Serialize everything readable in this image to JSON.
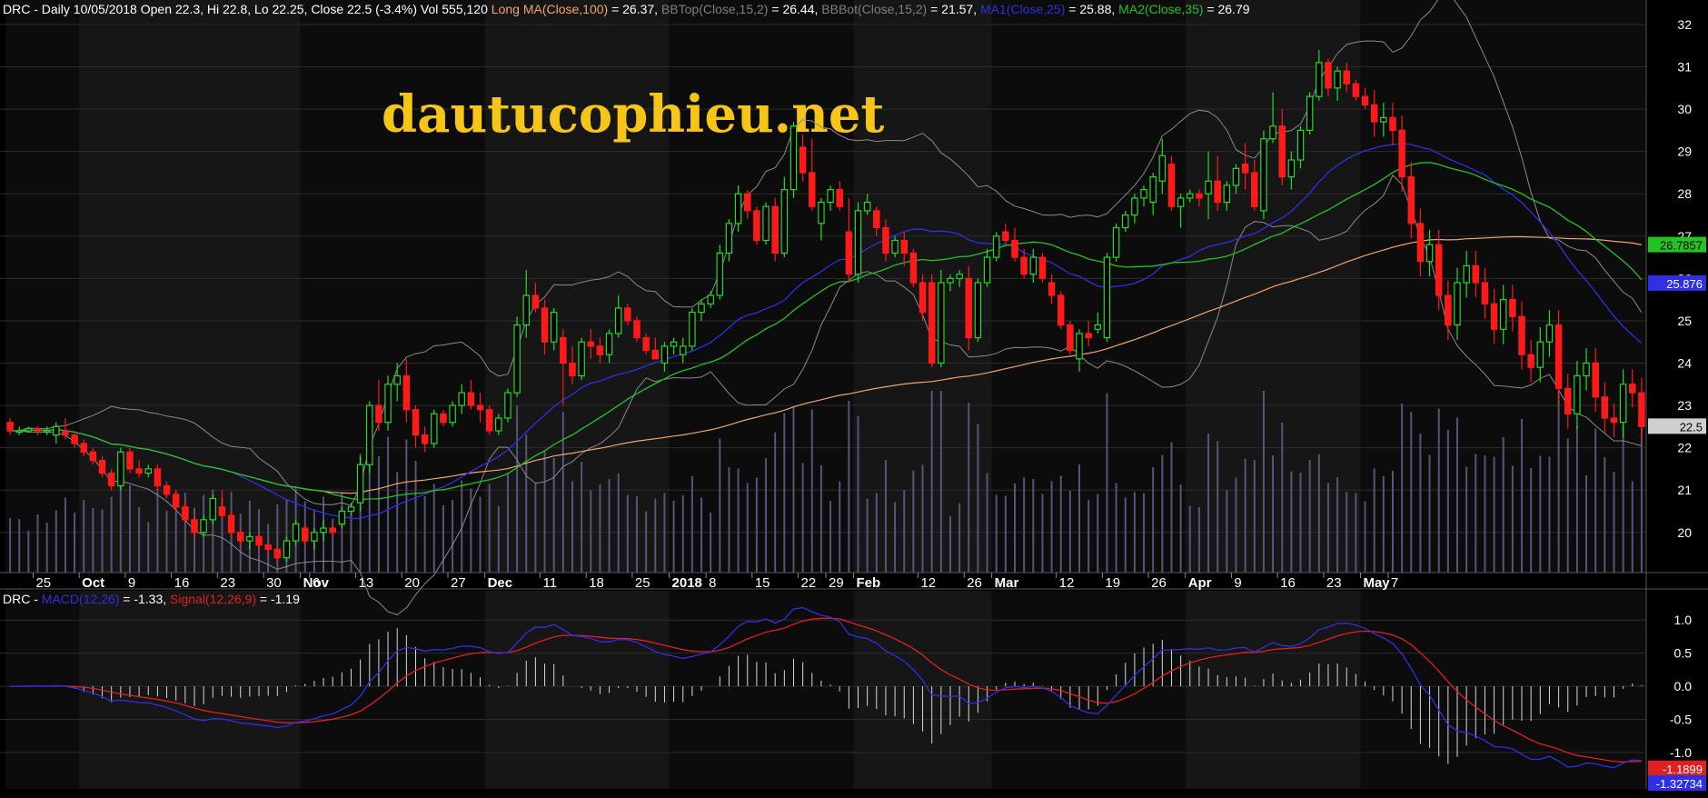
{
  "main_header": [
    {
      "text": "DRC - Daily 10/05/2018 Open 22.3, Hi 22.8, Lo 22.25, Close 22.5 (-3.4%) Vol 555,120 ",
      "color": "#ffffff"
    },
    {
      "text": "Long MA(Close,100)",
      "color": "#f3a46b"
    },
    {
      "text": " = 26.37, ",
      "color": "#ffffff"
    },
    {
      "text": "BBTop(Close,15,2)",
      "color": "#7f7f7f"
    },
    {
      "text": " = 26.44, ",
      "color": "#ffffff"
    },
    {
      "text": "BBBot(Close,15,2)",
      "color": "#7f7f7f"
    },
    {
      "text": " = 21.57, ",
      "color": "#ffffff"
    },
    {
      "text": "MA1(Close,25)",
      "color": "#2f2fe6"
    },
    {
      "text": " = 25.88, ",
      "color": "#ffffff"
    },
    {
      "text": "MA2(Close,35)",
      "color": "#22c322"
    },
    {
      "text": " = 26.79",
      "color": "#ffffff"
    }
  ],
  "macd_header": [
    {
      "text": "DRC - ",
      "color": "#ffffff"
    },
    {
      "text": "MACD(12,26)",
      "color": "#2f2fe6"
    },
    {
      "text": " = -1.33, ",
      "color": "#ffffff"
    },
    {
      "text": "Signal(12,26,9)",
      "color": "#e02020"
    },
    {
      "text": " = -1.19",
      "color": "#ffffff"
    }
  ],
  "watermark": "dautucophieu.net",
  "badges": {
    "ma2": "26.7857",
    "ma1": "25.876",
    "close": "22.5",
    "signal": "-1.1899",
    "macd": "-1.32734"
  },
  "chart_data": [
    {
      "type": "candlestick",
      "ticker": "DRC",
      "ylim": [
        19.05,
        32.15
      ],
      "y_ticks": [
        20,
        21,
        22,
        23,
        24,
        25,
        26,
        27,
        28,
        29,
        30,
        31,
        32
      ],
      "x_tick_labels": [
        {
          "label": "25",
          "bar": 3,
          "month": false
        },
        {
          "label": "Oct",
          "bar": 8,
          "month": true
        },
        {
          "label": "9",
          "bar": 13,
          "month": false
        },
        {
          "label": "16",
          "bar": 18,
          "month": false
        },
        {
          "label": "23",
          "bar": 23,
          "month": false
        },
        {
          "label": "30",
          "bar": 28,
          "month": false
        },
        {
          "label": "Nov",
          "bar": 32,
          "month": true
        },
        {
          "label": "6",
          "bar": 33,
          "month": false
        },
        {
          "label": "13",
          "bar": 38,
          "month": false
        },
        {
          "label": "20",
          "bar": 43,
          "month": false
        },
        {
          "label": "27",
          "bar": 48,
          "month": false
        },
        {
          "label": "Dec",
          "bar": 52,
          "month": true
        },
        {
          "label": "11",
          "bar": 58,
          "month": false
        },
        {
          "label": "18",
          "bar": 63,
          "month": false
        },
        {
          "label": "25",
          "bar": 68,
          "month": false
        },
        {
          "label": "2018",
          "bar": 72,
          "month": true
        },
        {
          "label": "8",
          "bar": 76,
          "month": false
        },
        {
          "label": "15",
          "bar": 81,
          "month": false
        },
        {
          "label": "22",
          "bar": 86,
          "month": false
        },
        {
          "label": "29",
          "bar": 89,
          "month": false
        },
        {
          "label": "Feb",
          "bar": 92,
          "month": true
        },
        {
          "label": "12",
          "bar": 99,
          "month": false
        },
        {
          "label": "26",
          "bar": 104,
          "month": false
        },
        {
          "label": "Mar",
          "bar": 107,
          "month": true
        },
        {
          "label": "12",
          "bar": 114,
          "month": false
        },
        {
          "label": "19",
          "bar": 119,
          "month": false
        },
        {
          "label": "26",
          "bar": 124,
          "month": false
        },
        {
          "label": "Apr",
          "bar": 128,
          "month": true
        },
        {
          "label": "9",
          "bar": 133,
          "month": false
        },
        {
          "label": "16",
          "bar": 138,
          "month": false
        },
        {
          "label": "23",
          "bar": 143,
          "month": false
        },
        {
          "label": "May",
          "bar": 147,
          "month": true
        },
        {
          "label": "7",
          "bar": 150,
          "month": false
        }
      ],
      "ohlc": [
        [
          22.6,
          22.7,
          22.3,
          22.4
        ],
        [
          22.4,
          22.5,
          22.3,
          22.4
        ],
        [
          22.4,
          22.5,
          22.35,
          22.45
        ],
        [
          22.45,
          22.5,
          22.3,
          22.4
        ],
        [
          22.4,
          22.5,
          22.3,
          22.4
        ],
        [
          22.3,
          22.6,
          22.1,
          22.5
        ],
        [
          22.4,
          22.7,
          22.2,
          22.3
        ],
        [
          22.3,
          22.4,
          22.0,
          22.1
        ],
        [
          22.1,
          22.2,
          21.8,
          21.9
        ],
        [
          21.9,
          22.0,
          21.6,
          21.7
        ],
        [
          21.7,
          21.8,
          21.3,
          21.4
        ],
        [
          21.4,
          21.5,
          21.0,
          21.1
        ],
        [
          21.1,
          22.0,
          21.0,
          21.9
        ],
        [
          21.9,
          22.0,
          21.4,
          21.5
        ],
        [
          21.5,
          21.7,
          21.3,
          21.4
        ],
        [
          21.4,
          21.6,
          21.3,
          21.5
        ],
        [
          21.5,
          21.6,
          21.0,
          21.1
        ],
        [
          21.1,
          21.2,
          20.8,
          20.9
        ],
        [
          20.9,
          21.0,
          20.5,
          20.6
        ],
        [
          20.6,
          20.8,
          20.2,
          20.3
        ],
        [
          20.3,
          20.4,
          19.9,
          20.0
        ],
        [
          20.0,
          20.4,
          19.9,
          20.3
        ],
        [
          20.3,
          20.9,
          20.2,
          20.8
        ],
        [
          20.6,
          21.0,
          20.3,
          20.4
        ],
        [
          20.4,
          20.5,
          19.9,
          20.0
        ],
        [
          20.0,
          20.1,
          19.7,
          19.8
        ],
        [
          19.8,
          20.0,
          19.6,
          19.9
        ],
        [
          19.9,
          20.0,
          19.6,
          19.7
        ],
        [
          19.7,
          19.8,
          19.5,
          19.6
        ],
        [
          19.6,
          19.7,
          19.3,
          19.4
        ],
        [
          19.4,
          19.9,
          19.3,
          19.8
        ],
        [
          19.8,
          20.3,
          19.7,
          20.2
        ],
        [
          20.1,
          20.2,
          19.7,
          19.8
        ],
        [
          19.8,
          20.1,
          19.6,
          20.0
        ],
        [
          20.0,
          20.3,
          19.8,
          20.1
        ],
        [
          20.1,
          20.2,
          19.9,
          20.0
        ],
        [
          20.2,
          20.6,
          20.1,
          20.5
        ],
        [
          20.5,
          20.7,
          20.4,
          20.6
        ],
        [
          20.7,
          21.8,
          20.5,
          21.6
        ],
        [
          21.6,
          23.1,
          21.4,
          23.0
        ],
        [
          23.0,
          23.6,
          22.4,
          22.6
        ],
        [
          22.6,
          23.7,
          22.4,
          23.5
        ],
        [
          23.5,
          24.0,
          23.1,
          23.7
        ],
        [
          23.7,
          24.1,
          22.6,
          22.9
        ],
        [
          22.9,
          23.0,
          22.0,
          22.3
        ],
        [
          22.3,
          22.5,
          21.9,
          22.1
        ],
        [
          22.1,
          22.9,
          22.0,
          22.8
        ],
        [
          22.8,
          22.9,
          22.5,
          22.6
        ],
        [
          22.6,
          23.1,
          22.5,
          23.0
        ],
        [
          23.0,
          23.5,
          22.8,
          23.3
        ],
        [
          23.3,
          23.6,
          22.9,
          23.0
        ],
        [
          23.0,
          23.3,
          22.6,
          22.9
        ],
        [
          22.9,
          23.0,
          22.3,
          22.4
        ],
        [
          22.4,
          22.8,
          22.3,
          22.7
        ],
        [
          22.7,
          23.4,
          22.6,
          23.3
        ],
        [
          23.3,
          25.1,
          23.2,
          24.9
        ],
        [
          24.9,
          26.2,
          24.6,
          25.6
        ],
        [
          25.6,
          25.9,
          25.2,
          25.3
        ],
        [
          25.3,
          25.5,
          24.2,
          24.5
        ],
        [
          24.5,
          25.3,
          24.3,
          25.2
        ],
        [
          24.6,
          24.8,
          23.0,
          24.0
        ],
        [
          24.0,
          24.4,
          23.5,
          23.7
        ],
        [
          23.7,
          24.6,
          23.6,
          24.5
        ],
        [
          24.5,
          24.8,
          24.1,
          24.4
        ],
        [
          24.4,
          24.6,
          24.0,
          24.2
        ],
        [
          24.2,
          24.8,
          24.0,
          24.7
        ],
        [
          24.7,
          25.6,
          24.6,
          25.3
        ],
        [
          25.3,
          25.4,
          24.9,
          25.0
        ],
        [
          25.0,
          25.1,
          24.5,
          24.6
        ],
        [
          24.6,
          24.7,
          24.2,
          24.3
        ],
        [
          24.3,
          24.6,
          24.1,
          24.1
        ],
        [
          24.0,
          24.5,
          23.8,
          24.4
        ],
        [
          24.4,
          24.6,
          24.2,
          24.5
        ],
        [
          24.2,
          24.6,
          24.0,
          24.4
        ],
        [
          24.4,
          25.3,
          24.3,
          25.2
        ],
        [
          25.2,
          25.5,
          25.0,
          25.4
        ],
        [
          25.4,
          25.7,
          25.3,
          25.6
        ],
        [
          25.6,
          26.8,
          25.5,
          26.6
        ],
        [
          26.6,
          27.4,
          26.4,
          27.3
        ],
        [
          27.3,
          28.2,
          27.1,
          28.0
        ],
        [
          28.0,
          28.1,
          27.4,
          27.6
        ],
        [
          27.6,
          27.7,
          26.8,
          26.9
        ],
        [
          26.9,
          27.8,
          26.8,
          27.7
        ],
        [
          27.7,
          27.9,
          26.4,
          26.6
        ],
        [
          26.6,
          28.4,
          26.5,
          28.1
        ],
        [
          28.1,
          29.7,
          27.9,
          29.6
        ],
        [
          29.1,
          29.4,
          28.3,
          28.5
        ],
        [
          28.5,
          29.3,
          27.6,
          27.7
        ],
        [
          27.3,
          27.9,
          26.9,
          27.8
        ],
        [
          27.8,
          28.2,
          27.6,
          28.1
        ],
        [
          28.1,
          28.3,
          27.6,
          27.7
        ],
        [
          27.1,
          27.9,
          25.9,
          26.1
        ],
        [
          26.1,
          27.8,
          25.9,
          27.6
        ],
        [
          27.6,
          28.0,
          27.5,
          27.8
        ],
        [
          27.6,
          27.7,
          27.0,
          27.2
        ],
        [
          27.2,
          27.4,
          26.4,
          26.6
        ],
        [
          26.6,
          27.0,
          26.5,
          26.9
        ],
        [
          26.9,
          27.1,
          26.3,
          26.6
        ],
        [
          26.6,
          26.7,
          25.8,
          25.9
        ],
        [
          25.9,
          26.1,
          25.0,
          25.2
        ],
        [
          25.9,
          26.1,
          23.9,
          24.0
        ],
        [
          24.0,
          26.2,
          23.9,
          25.9
        ],
        [
          25.9,
          26.1,
          25.7,
          26.0
        ],
        [
          26.0,
          26.2,
          25.8,
          26.1
        ],
        [
          26.0,
          26.3,
          24.3,
          24.6
        ],
        [
          24.6,
          26.0,
          24.5,
          25.9
        ],
        [
          25.9,
          26.7,
          25.8,
          26.5
        ],
        [
          26.5,
          27.1,
          26.4,
          27.0
        ],
        [
          27.1,
          27.3,
          26.8,
          26.9
        ],
        [
          26.9,
          27.2,
          26.4,
          26.5
        ],
        [
          26.5,
          26.7,
          26.0,
          26.1
        ],
        [
          26.1,
          26.7,
          25.9,
          26.5
        ],
        [
          26.5,
          26.6,
          25.9,
          26.0
        ],
        [
          25.9,
          26.1,
          25.4,
          25.6
        ],
        [
          25.6,
          25.7,
          24.8,
          24.9
        ],
        [
          24.9,
          25.0,
          24.2,
          24.3
        ],
        [
          24.1,
          24.8,
          23.8,
          24.7
        ],
        [
          24.7,
          25.0,
          24.4,
          24.6
        ],
        [
          24.8,
          25.2,
          24.7,
          24.9
        ],
        [
          24.6,
          26.6,
          24.5,
          26.5
        ],
        [
          26.5,
          27.3,
          26.4,
          27.2
        ],
        [
          27.2,
          27.6,
          27.1,
          27.5
        ],
        [
          27.5,
          28.0,
          27.3,
          27.9
        ],
        [
          27.9,
          28.2,
          27.7,
          28.1
        ],
        [
          27.8,
          28.5,
          27.5,
          28.4
        ],
        [
          28.3,
          29.3,
          28.0,
          28.9
        ],
        [
          28.7,
          28.9,
          27.6,
          27.7
        ],
        [
          27.7,
          28.0,
          27.2,
          27.9
        ],
        [
          27.9,
          28.1,
          27.8,
          28.0
        ],
        [
          28.0,
          28.1,
          27.7,
          27.9
        ],
        [
          28.0,
          29.0,
          27.4,
          28.3
        ],
        [
          28.3,
          28.9,
          27.6,
          27.8
        ],
        [
          27.8,
          28.3,
          27.6,
          28.2
        ],
        [
          28.2,
          28.7,
          28.0,
          28.6
        ],
        [
          28.7,
          29.2,
          28.1,
          28.5
        ],
        [
          28.5,
          28.8,
          27.6,
          27.7
        ],
        [
          27.6,
          29.5,
          27.4,
          29.3
        ],
        [
          29.3,
          30.4,
          29.2,
          29.6
        ],
        [
          29.6,
          30.0,
          28.2,
          28.4
        ],
        [
          28.4,
          29.0,
          28.1,
          28.8
        ],
        [
          28.8,
          29.6,
          28.6,
          29.5
        ],
        [
          29.5,
          30.4,
          29.4,
          30.3
        ],
        [
          30.3,
          31.4,
          30.2,
          31.1
        ],
        [
          31.1,
          31.2,
          30.3,
          30.5
        ],
        [
          30.5,
          31.0,
          30.2,
          30.9
        ],
        [
          30.9,
          31.1,
          30.4,
          30.6
        ],
        [
          30.6,
          30.7,
          30.2,
          30.3
        ],
        [
          30.3,
          30.5,
          30.0,
          30.1
        ]
      ],
      "closes_reference": "",
      "volume": [],
      "overlays": [
        {
          "name": "Long MA(Close,100)",
          "value": 26.37,
          "color": "#f3a46b"
        },
        {
          "name": "BBTop(Close,15,2)",
          "value": 26.44,
          "color": "#7f7f7f"
        },
        {
          "name": "BBBot(Close,15,2)",
          "value": 21.57,
          "color": "#7f7f7f"
        },
        {
          "name": "MA1(Close,25)",
          "value": 25.88,
          "color": "#2f2fe6"
        },
        {
          "name": "MA2(Close,35)",
          "value": 26.79,
          "color": "#22c322"
        }
      ],
      "last_bar": {
        "date": "10/05/2018",
        "open": 22.3,
        "high": 22.8,
        "low": 22.25,
        "close": 22.5,
        "change_pct": -3.4,
        "volume": 555120
      },
      "grid": true
    },
    {
      "type": "macd",
      "ylim": [
        -1.55,
        1.25
      ],
      "y_ticks": [
        1.0,
        0.5,
        0.0,
        -0.5,
        -1.0
      ],
      "macd": {
        "name": "MACD(12,26)",
        "last": -1.33,
        "color": "#2f2fe6"
      },
      "signal": {
        "name": "Signal(12,26,9)",
        "last": -1.19,
        "color": "#e02020"
      },
      "grid": true
    }
  ]
}
